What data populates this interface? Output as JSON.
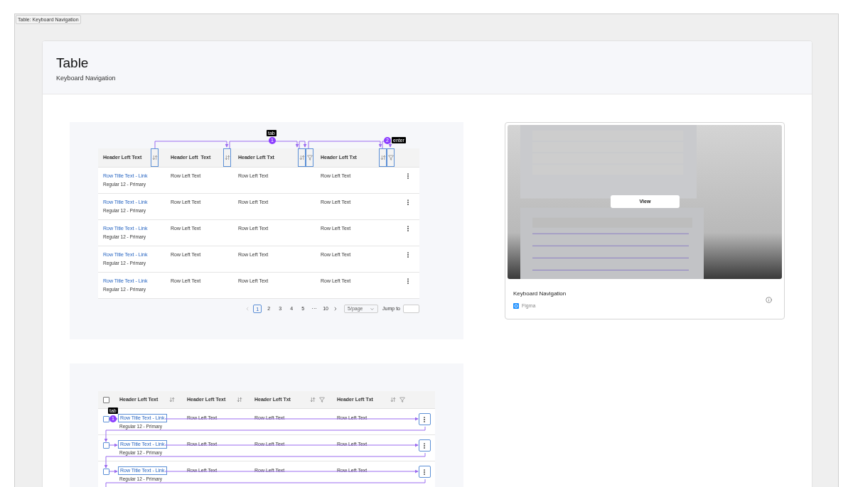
{
  "tag": "Table: Keyboard Navigation",
  "header": {
    "title": "Table",
    "subtitle": "Keyboard Navigation"
  },
  "examples": [
    {
      "kind": "header-focus",
      "steps": [
        {
          "badge": "1",
          "key": "tab"
        },
        {
          "badge": "2",
          "key": "enter"
        }
      ],
      "columns": [
        {
          "label": "Header Left Text",
          "actions": [
            {
              "kind": "sort"
            }
          ]
        },
        {
          "label": "Header Left  Text",
          "actions": [
            {
              "kind": "sort"
            }
          ]
        },
        {
          "label": "Header Left Txt",
          "actions": [
            {
              "kind": "sort"
            },
            {
              "kind": "filter"
            }
          ]
        },
        {
          "label": "Header Left Txt",
          "actions": [
            {
              "kind": "sort"
            },
            {
              "kind": "filter"
            }
          ]
        }
      ],
      "rows": [
        {
          "cells": [
            "Row Title Text - Link",
            "Row Left Text",
            "Row Left Text",
            "Row Left Text"
          ],
          "subtitle": "Regular 12 - Primary"
        },
        {
          "cells": [
            "Row Title Text - Link",
            "Row Left Text",
            "Row Left Text",
            "Row Left Text"
          ],
          "subtitle": "Regular 12 - Primary"
        },
        {
          "cells": [
            "Row Title Text - Link",
            "Row Left Text",
            "Row Left Text",
            "Row Left Text"
          ],
          "subtitle": "Regular 12 - Primary"
        },
        {
          "cells": [
            "Row Title Text - Link",
            "Row Left Text",
            "Row Left Text",
            "Row Left Text"
          ],
          "subtitle": "Regular 12 - Primary"
        },
        {
          "cells": [
            "Row Title Text - Link",
            "Row Left Text",
            "Row Left Text",
            "Row Left Text"
          ],
          "subtitle": "Regular 12 - Primary"
        }
      ],
      "pagination": {
        "prev_disabled": true,
        "pages": [
          {
            "label": "1",
            "selected": true
          },
          {
            "label": "2",
            "selected": false
          },
          {
            "label": "3",
            "selected": false
          },
          {
            "label": "4",
            "selected": false
          },
          {
            "label": "5",
            "selected": false
          },
          {
            "label": "···",
            "selected": false
          },
          {
            "label": "10",
            "selected": false
          }
        ],
        "page_size": "5/page",
        "jump_label": "Jump to"
      }
    },
    {
      "kind": "row-focus",
      "steps": [
        {
          "badge": "1",
          "key": "tab"
        }
      ],
      "header_checkbox": {
        "checked": false
      },
      "columns": [
        {
          "label": "Header Left Text",
          "actions": [
            {
              "kind": "sort"
            }
          ]
        },
        {
          "label": "Header Left Text",
          "actions": [
            {
              "kind": "sort"
            }
          ]
        },
        {
          "label": "Header Left Txt",
          "actions": [
            {
              "kind": "sort"
            },
            {
              "kind": "filter"
            }
          ]
        },
        {
          "label": "Header Left Txt",
          "actions": [
            {
              "kind": "sort"
            },
            {
              "kind": "filter"
            }
          ]
        }
      ],
      "rows": [
        {
          "checked": false,
          "cells": [
            "Row Title Text - Link",
            "Row Left Text",
            "Row Left Text",
            "Row Left Text"
          ],
          "subtitle": "Regular 12 - Primary"
        },
        {
          "checked": false,
          "cells": [
            "Row Title Text - Link",
            "Row Left Text",
            "Row Left Text",
            "Row Left Text"
          ],
          "subtitle": "Regular 12 - Primary"
        },
        {
          "checked": false,
          "cells": [
            "Row Title Text - Link",
            "Row Left Text",
            "Row Left Text",
            "Row Left Text"
          ],
          "subtitle": "Regular 12 - Primary"
        }
      ]
    }
  ],
  "preview_card": {
    "button": "View",
    "title": "Keyboard Navigation",
    "source": "Figma"
  }
}
